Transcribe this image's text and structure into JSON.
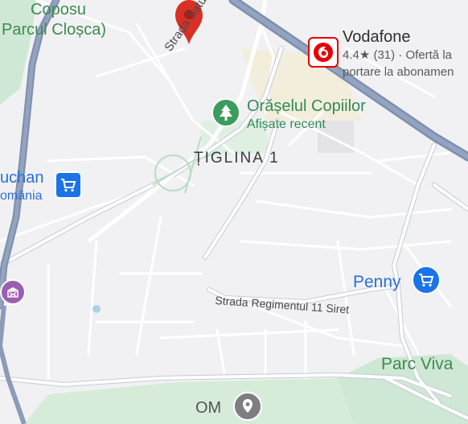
{
  "map": {
    "labels": {
      "park_top_line1": "Coposu",
      "park_top_line2": "Parcul Cloșca)",
      "shop_left_line1": "uchan",
      "shop_left_line2": "omânia",
      "vodafone_name": "Vodafone",
      "vodafone_rating": "4.4★ (31) · Ofertă la",
      "vodafone_desc": "portare la abonamen",
      "orasel_name": "Orășelul Copiilor",
      "orasel_sub": "Afișate recent",
      "district": "ȚIGLINA 1",
      "street_saturn": "Strada Saturn",
      "street_regiment": "Strada Regimentul 11 Siret",
      "penny": "Penny",
      "parc_viva": "Parc Viva",
      "om": "OM"
    },
    "icons": {
      "dropped_pin": "map-pin-icon",
      "vodafone": "vodafone-logo-icon",
      "orasel": "tree-icon",
      "shop_left": "shopping-cart-icon",
      "penny": "shopping-cart-icon",
      "museum_left": "museum-icon",
      "om_pin": "location-pin-icon"
    },
    "colors": {
      "background": "#f1f1f4",
      "highway": "#8b9bb8",
      "park": "#cfe8d5",
      "blue_poi": "#1a73e8",
      "pin_red": "#d93025",
      "vodafone_red": "#e60000",
      "green_poi": "#3b9c5c"
    }
  }
}
